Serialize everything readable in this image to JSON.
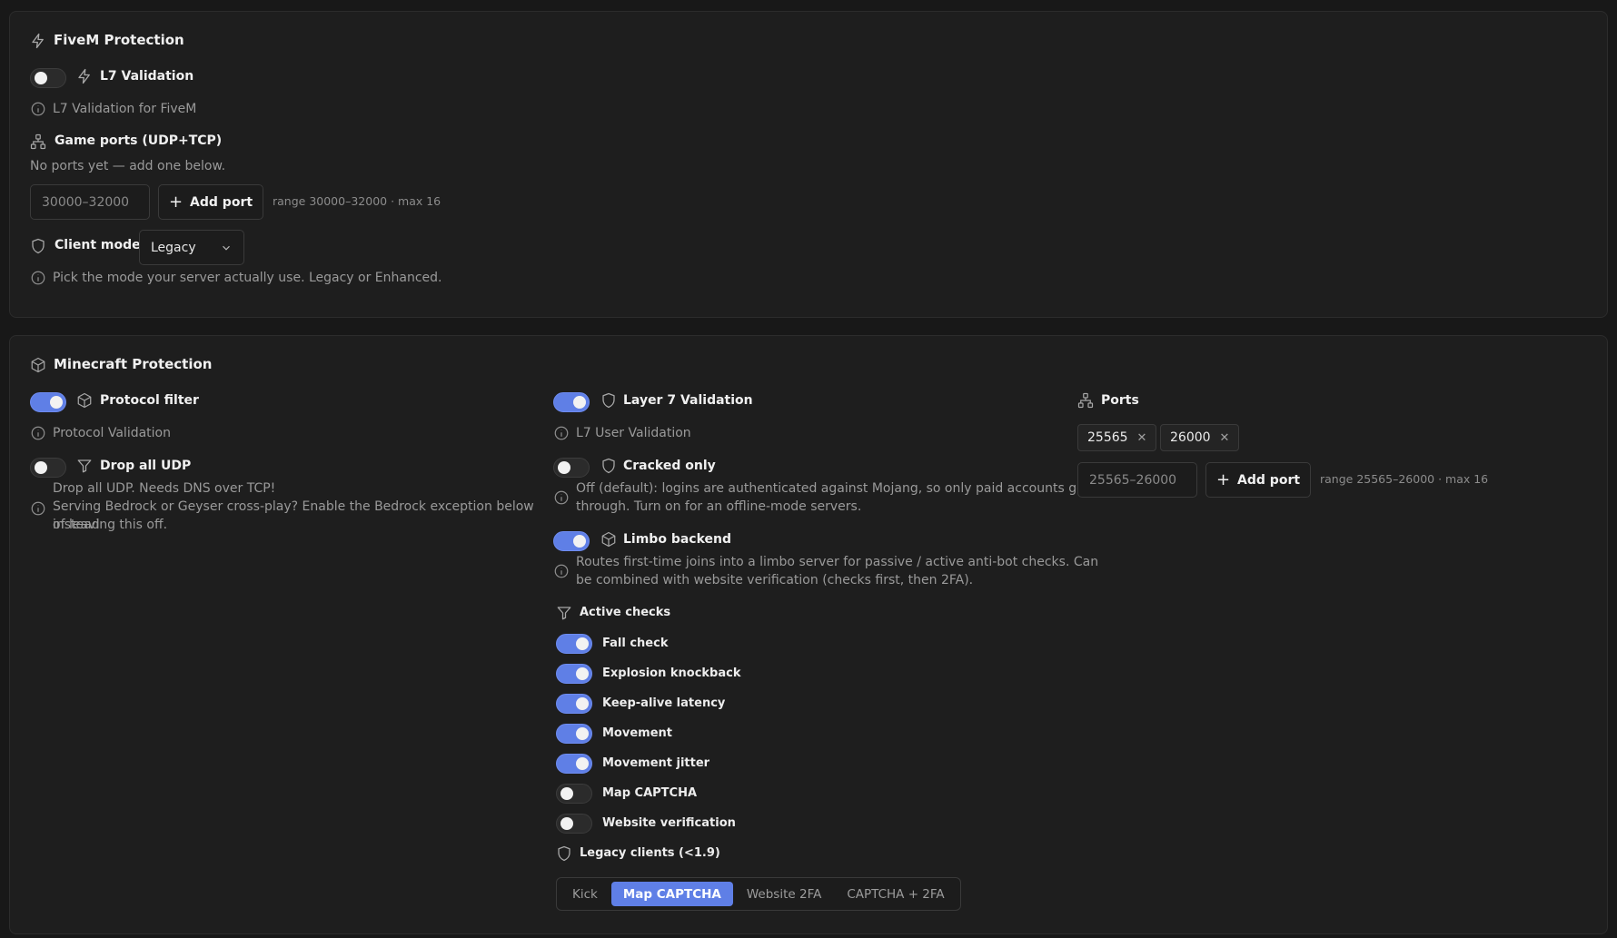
{
  "fivem": {
    "title": "FiveM Protection",
    "l7": {
      "label": "L7 Validation",
      "enabled": false,
      "hint": "L7 Validation for FiveM"
    },
    "game_ports": {
      "label": "Game ports (UDP+TCP)",
      "empty_text": "No ports yet — add one below.",
      "input_placeholder": "30000–32000",
      "add_button": "Add port",
      "range_hint": "range 30000–32000 · max 16"
    },
    "client_mode": {
      "label": "Client mode",
      "value": "Legacy",
      "hint": "Pick the mode your server actually use. Legacy or Enhanced."
    }
  },
  "minecraft": {
    "title": "Minecraft Protection",
    "protocol_filter": {
      "label": "Protocol filter",
      "enabled": true,
      "hint": "Protocol Validation"
    },
    "drop_udp": {
      "label": "Drop all UDP",
      "enabled": false,
      "description": "Drop all UDP. Needs DNS over TCP!",
      "hint_line1": "Serving Bedrock or Geyser cross-play? Enable the Bedrock exception below instead",
      "hint_line2": "of leaving this off."
    },
    "layer7": {
      "label": "Layer 7 Validation",
      "enabled": true,
      "hint": "L7 User Validation"
    },
    "cracked_only": {
      "label": "Cracked only",
      "enabled": false,
      "hint_line1": "Off (default): logins are authenticated against Mojang, so only paid accounts get",
      "hint_line2": "through. Turn on for an offline-mode servers."
    },
    "limbo": {
      "label": "Limbo backend",
      "enabled": true,
      "hint_line1": "Routes first-time joins into a limbo server for passive / active anti-bot checks. Can",
      "hint_line2": "be combined with website verification (checks first, then 2FA)."
    },
    "active_checks": {
      "label": "Active checks",
      "items": [
        {
          "label": "Fall check",
          "enabled": true
        },
        {
          "label": "Explosion knockback",
          "enabled": true
        },
        {
          "label": "Keep-alive latency",
          "enabled": true
        },
        {
          "label": "Movement",
          "enabled": true
        },
        {
          "label": "Movement jitter",
          "enabled": true
        },
        {
          "label": "Map CAPTCHA",
          "enabled": false
        },
        {
          "label": "Website verification",
          "enabled": false
        }
      ]
    },
    "legacy_clients": {
      "label": "Legacy clients (<1.9)",
      "options": [
        "Kick",
        "Map CAPTCHA",
        "Website 2FA",
        "CAPTCHA + 2FA"
      ],
      "selected": "Map CAPTCHA"
    },
    "ports": {
      "label": "Ports",
      "chips": [
        "25565",
        "26000"
      ],
      "input_placeholder": "25565–26000",
      "add_button": "Add port",
      "range_hint": "range 25565–26000 · max 16"
    }
  },
  "colors": {
    "accent": "#5f7fe6",
    "panel": "#1e1e1e",
    "background": "#181818"
  }
}
